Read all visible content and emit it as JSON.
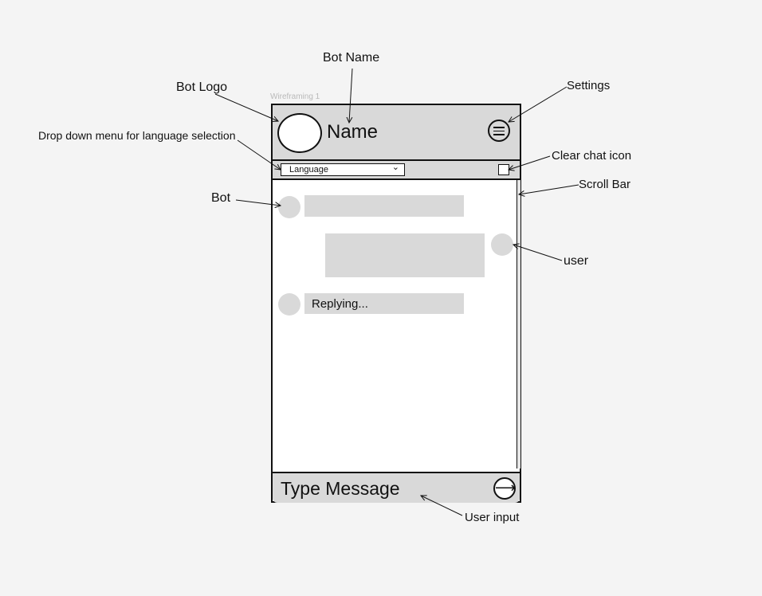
{
  "frame_label": "Wireframing 1",
  "annotations": {
    "bot_name": "Bot Name",
    "bot_logo": "Bot Logo",
    "settings": "Settings",
    "language_dropdown": "Drop down menu for language selection",
    "clear_chat": "Clear chat icon",
    "scroll_bar": "Scroll Bar",
    "bot": "Bot",
    "user": "user",
    "user_input": "User input"
  },
  "chat": {
    "header": {
      "name": "Name",
      "logo_icon": "bot-logo-circle",
      "settings_icon": "hamburger-menu-icon"
    },
    "language_bar": {
      "select_value": "Language",
      "chevron_icon": "chevron-down-icon",
      "clear_icon": "clear-chat-icon"
    },
    "messages": [
      {
        "sender": "bot",
        "text": ""
      },
      {
        "sender": "user",
        "text": ""
      },
      {
        "sender": "bot",
        "text": "Replying..."
      }
    ],
    "input": {
      "placeholder": "Type Message",
      "send_icon": "arrow-right-icon"
    }
  }
}
